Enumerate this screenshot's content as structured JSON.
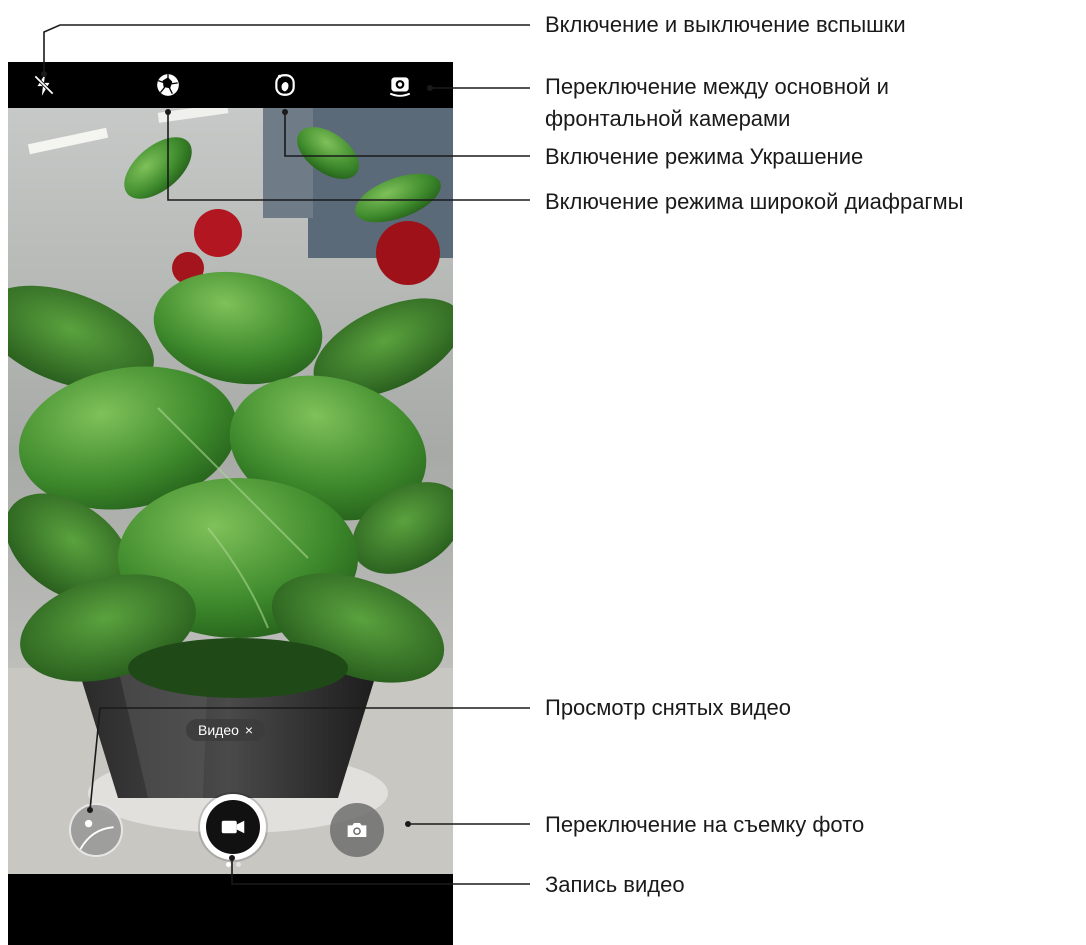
{
  "camera": {
    "mode_chip": {
      "label": "Видео",
      "close_glyph": "×"
    },
    "icons": {
      "flash": "flash-off-icon",
      "aperture": "aperture-icon",
      "beauty": "beauty-icon",
      "switch_camera": "camera-switch-icon",
      "gallery": "gallery-thumbnail-icon",
      "record": "video-record-icon",
      "photo": "camera-photo-icon"
    }
  },
  "callouts": {
    "flash": "Включение и выключение вспышки",
    "switch_camera_line1": "Переключение между основной и",
    "switch_camera_line2": "фронтальной камерами",
    "beauty": "Включение режима Украшение",
    "aperture": "Включение режима широкой диафрагмы",
    "gallery": "Просмотр снятых видео",
    "photo_mode": "Переключение на съемку фото",
    "record": "Запись видео"
  },
  "colors": {
    "accent_line": "#1a1a1a",
    "plant_green": "#3f8a2c",
    "rose_red": "#b21620"
  }
}
